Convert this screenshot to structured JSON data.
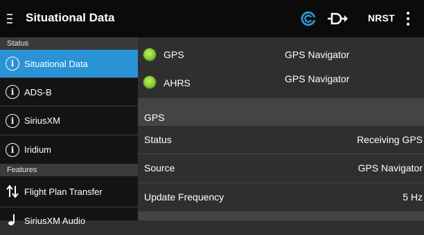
{
  "toolbar": {
    "title": "Situational Data",
    "nrst_label": "NRST",
    "icons": [
      "menu-icon",
      "connectivity-icon",
      "flight-plan-transfer-icon",
      "more-vert-icon"
    ],
    "accent_color": "#2a93d5"
  },
  "sidebar": {
    "sections": [
      {
        "header": "Status",
        "items": [
          {
            "label": "Situational Data",
            "icon": "info-icon",
            "active": true
          },
          {
            "label": "ADS-B",
            "icon": "info-icon",
            "active": false
          },
          {
            "label": "SiriusXM",
            "icon": "info-icon",
            "active": false
          },
          {
            "label": "Iridium",
            "icon": "info-icon",
            "active": false
          }
        ]
      },
      {
        "header": "Features",
        "items": [
          {
            "label": "Flight Plan Transfer",
            "icon": "transfer-arrows-icon",
            "active": false
          },
          {
            "label": "SiriusXM Audio",
            "icon": "music-note-icon",
            "active": false
          }
        ]
      }
    ]
  },
  "devices": [
    {
      "name": "GPS",
      "value": "GPS Navigator",
      "status_color": "#8fd13c"
    },
    {
      "name": "AHRS",
      "value": "GPS Navigator",
      "status_color": "#8fd13c"
    }
  ],
  "gps_group": {
    "title": "GPS",
    "rows": [
      {
        "key": "Status",
        "value": "Receiving GPS"
      },
      {
        "key": "Source",
        "value": "GPS Navigator"
      },
      {
        "key": "Update Frequency",
        "value": "5 Hz"
      }
    ]
  }
}
